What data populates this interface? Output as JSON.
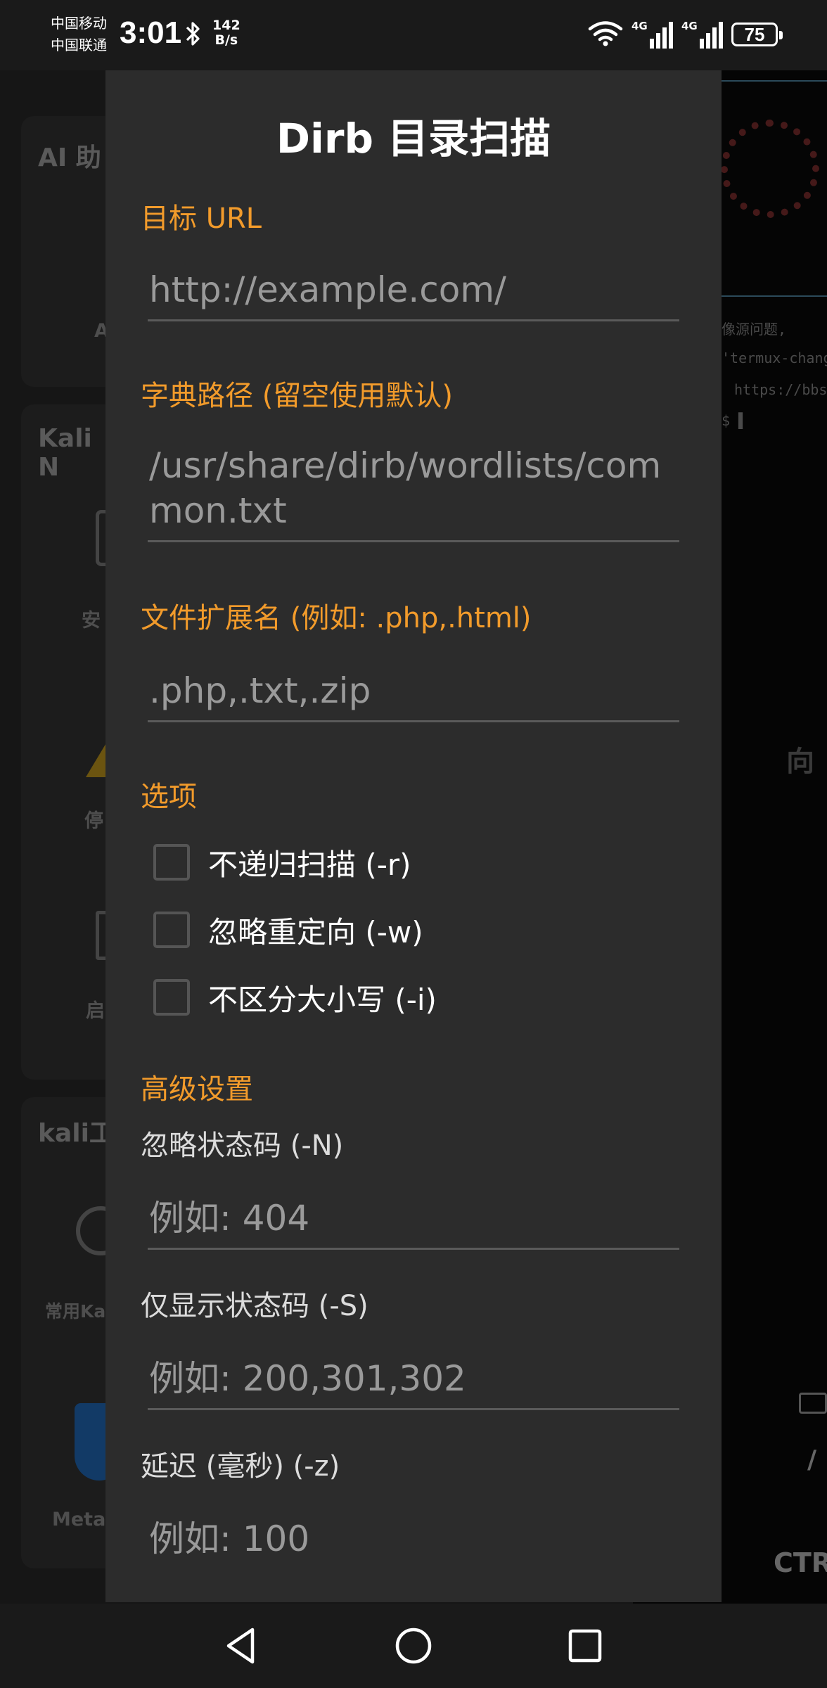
{
  "status_bar": {
    "carrier_1": "中国移动",
    "carrier_2": "中国联通",
    "time": "3:01",
    "net_speed_value": "142",
    "net_speed_unit": "B/s",
    "sim1_tag": "4G",
    "sim2_tag": "4G",
    "battery": "75"
  },
  "background": {
    "card1_title": "AI 助",
    "card1_label": "A",
    "card2_title": "Kali N",
    "card2_item1": "安",
    "card2_item2": "停",
    "card2_item3": "启",
    "card3_title": "kali工",
    "card3_item1": "常用Ka",
    "card3_item2": "Metas",
    "terminal_line1": "像源问题,",
    "terminal_line2": "'termux-chang",
    "terminal_line3": "https://bbs.",
    "terminal_line4": "$ ▌",
    "terminal_side": "向",
    "terminal_key1": "/",
    "terminal_key2": "CTR"
  },
  "dialog": {
    "title": "Dirb 目录扫描",
    "target_url_label": "目标 URL",
    "target_url_placeholder": "http://example.com/",
    "wordlist_label": "字典路径 (留空使用默认)",
    "wordlist_placeholder": "/usr/share/dirb/wordlists/common.txt",
    "extensions_label": "文件扩展名 (例如: .php,.html)",
    "extensions_placeholder": ".php,.txt,.zip",
    "options_label": "选项",
    "options": [
      {
        "label": "不递归扫描 (-r)",
        "checked": false
      },
      {
        "label": "忽略重定向 (-w)",
        "checked": false
      },
      {
        "label": "不区分大小写 (-i)",
        "checked": false
      }
    ],
    "advanced_label": "高级设置",
    "ignore_codes_label": "忽略状态码 (-N)",
    "ignore_codes_placeholder": "例如: 404",
    "show_codes_label": "仅显示状态码 (-S)",
    "show_codes_placeholder": "例如: 200,301,302",
    "delay_label": "延迟 (毫秒) (-z)",
    "delay_placeholder": "例如: 100"
  },
  "colors": {
    "accent": "#f29b2b",
    "dialog_bg": "#2c2c2c",
    "placeholder": "#9a9a9a"
  },
  "nav": {
    "back_icon": "back-triangle-icon",
    "home_icon": "home-circle-icon",
    "recents_icon": "recents-square-icon"
  }
}
